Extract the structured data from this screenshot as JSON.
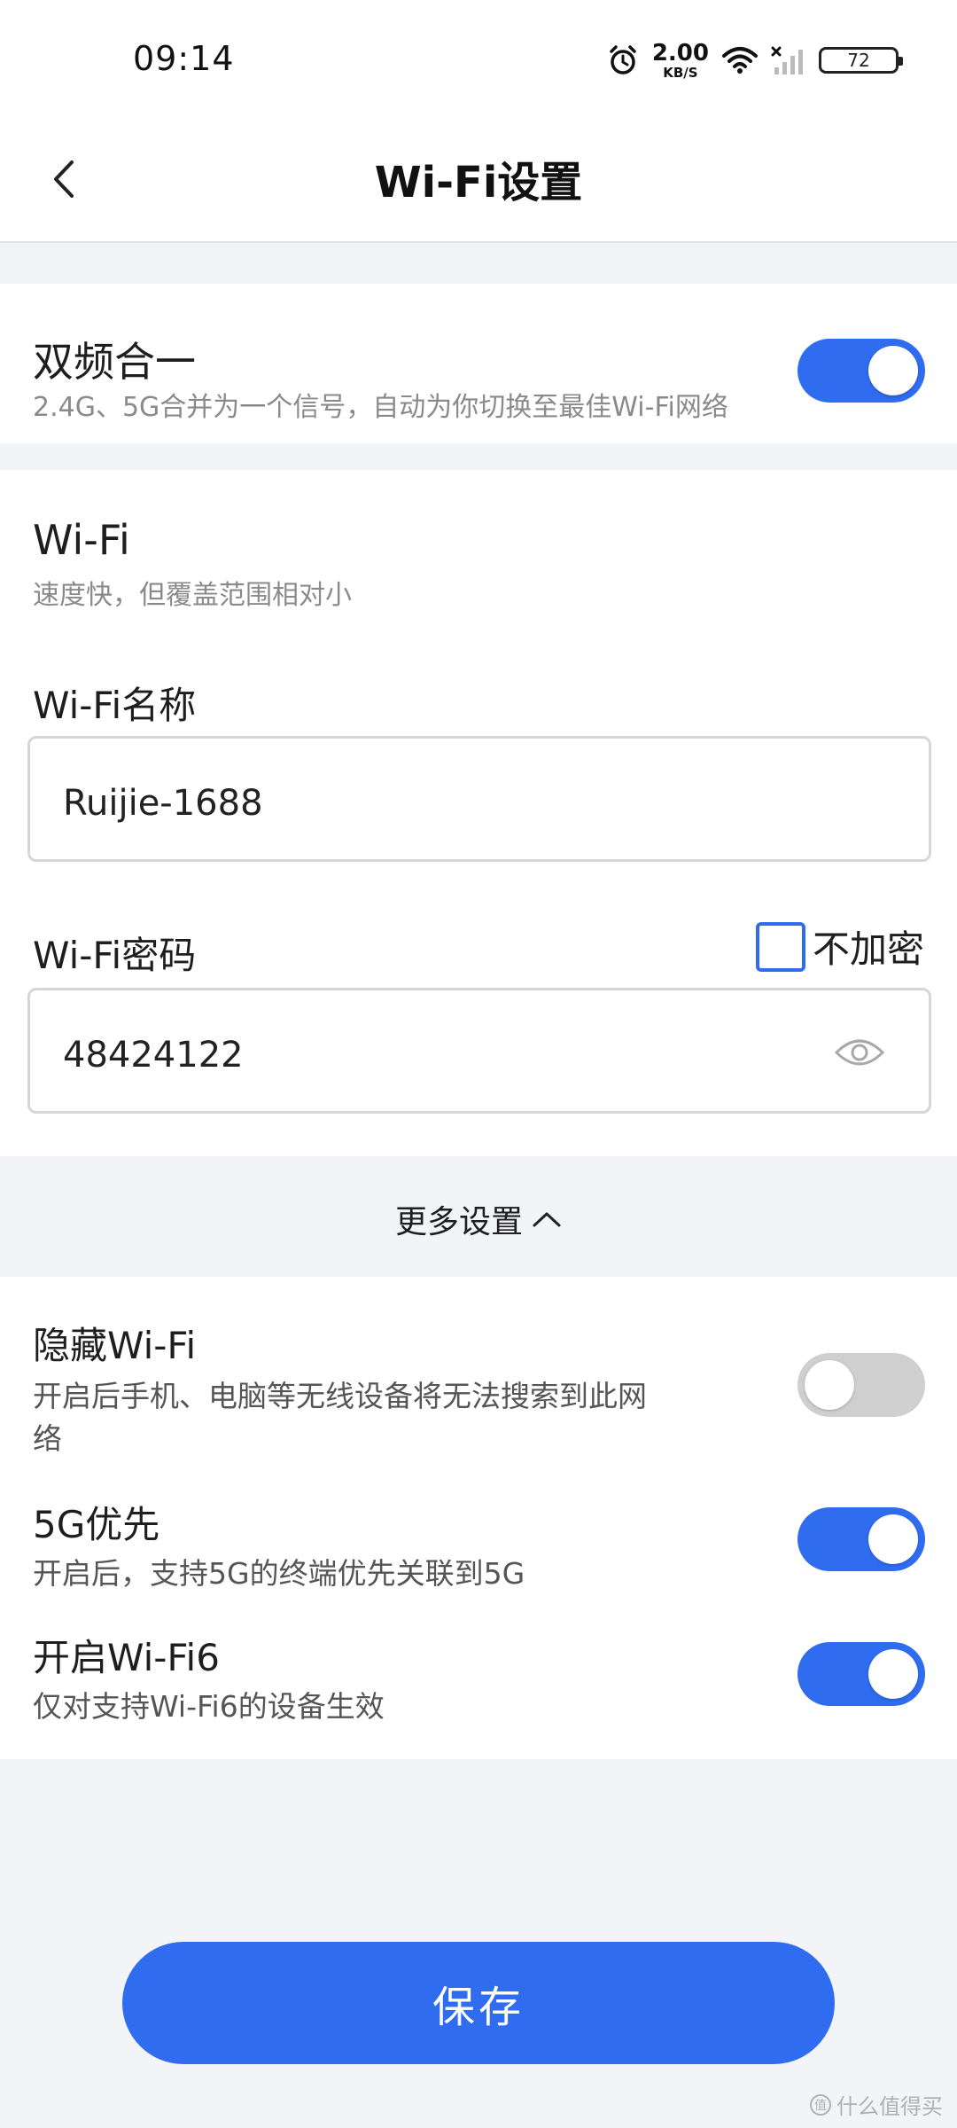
{
  "status_bar": {
    "time": "09:14",
    "net_speed": "2.00",
    "net_speed_unit": "KB/S",
    "battery": "72",
    "icons": [
      "alarm-icon",
      "wifi-icon",
      "cell-signal-icon",
      "battery-icon"
    ]
  },
  "header": {
    "title": "Wi-Fi设置",
    "back_icon": "chevron-left-icon"
  },
  "dual_band": {
    "title": "双频合一",
    "subtitle": "2.4G、5G合并为一个信号，自动为你切换至最佳Wi-Fi网络",
    "enabled": true
  },
  "wifi": {
    "title": "Wi-Fi",
    "subtitle": "速度快，但覆盖范围相对小",
    "name_label": "Wi-Fi名称",
    "name_value": "Ruijie-1688",
    "password_label": "Wi-Fi密码",
    "no_encrypt_label": "不加密",
    "no_encrypt_checked": false,
    "password_value": "48424122",
    "eye_icon": "eye-icon"
  },
  "more_settings": {
    "label": "更多设置",
    "icon": "chevron-up-icon"
  },
  "advanced": {
    "hide_wifi": {
      "title": "隐藏Wi-Fi",
      "subtitle_line1": "开启后手机、电脑等无线设备将无法搜索到此网",
      "subtitle_line2": "络",
      "enabled": false
    },
    "prefer_5g": {
      "title": "5G优先",
      "subtitle": "开启后，支持5G的终端优先关联到5G",
      "enabled": true
    },
    "wifi6": {
      "title": "开启Wi-Fi6",
      "subtitle": "仅对支持Wi-Fi6的设备生效",
      "enabled": true
    }
  },
  "save_button": "保存",
  "watermark": "什么值得买",
  "colors": {
    "accent": "#2f6cf0",
    "page_bg": "#f3f4f8",
    "toggle_off": "#cfcfcf",
    "subtext": "#8a8a8a"
  }
}
